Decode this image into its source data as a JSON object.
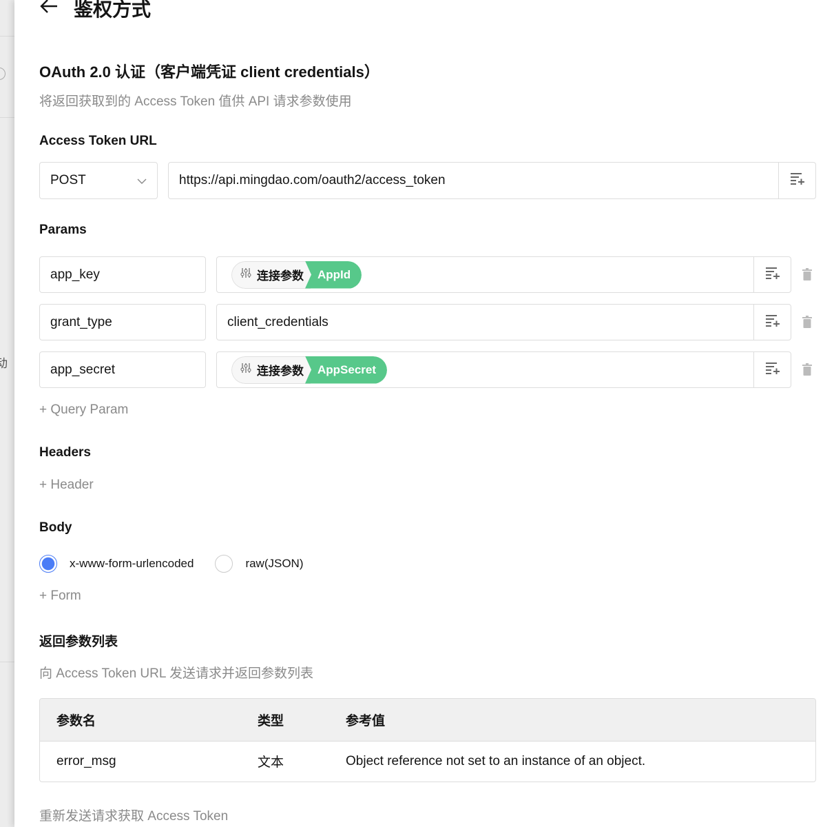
{
  "backdrop": {
    "fragment": "动"
  },
  "header": {
    "title": "鉴权方式",
    "back_icon": "arrow-left-icon"
  },
  "auth": {
    "title": "OAuth 2.0 认证（客户端凭证 client credentials）",
    "description": "将返回获取到的 Access Token 值供 API 请求参数使用"
  },
  "token_url": {
    "label": "Access Token URL",
    "method": "POST",
    "url": "https://api.mingdao.com/oauth2/access_token"
  },
  "params": {
    "label": "Params",
    "rows": [
      {
        "key": "app_key",
        "chip_label": "连接参数",
        "chip_value": "AppId"
      },
      {
        "key": "grant_type",
        "value": "client_credentials"
      },
      {
        "key": "app_secret",
        "chip_label": "连接参数",
        "chip_value": "AppSecret"
      }
    ],
    "add_label": "+ Query Param"
  },
  "headers": {
    "label": "Headers",
    "add_label": "+ Header"
  },
  "body": {
    "label": "Body",
    "options": [
      "x-www-form-urlencoded",
      "raw(JSON)"
    ],
    "selected": "x-www-form-urlencoded",
    "add_label": "+ Form"
  },
  "response": {
    "label": "返回参数列表",
    "description": "向 Access Token URL 发送请求并返回参数列表",
    "columns": [
      "参数名",
      "类型",
      "参考值"
    ],
    "rows": [
      {
        "name": "error_msg",
        "type": "文本",
        "value": "Object reference not set to an instance of an object."
      }
    ]
  },
  "resend": "重新发送请求获取 Access Token",
  "colors": {
    "accent": "#4a7cf6",
    "chip": "#57c88a"
  }
}
